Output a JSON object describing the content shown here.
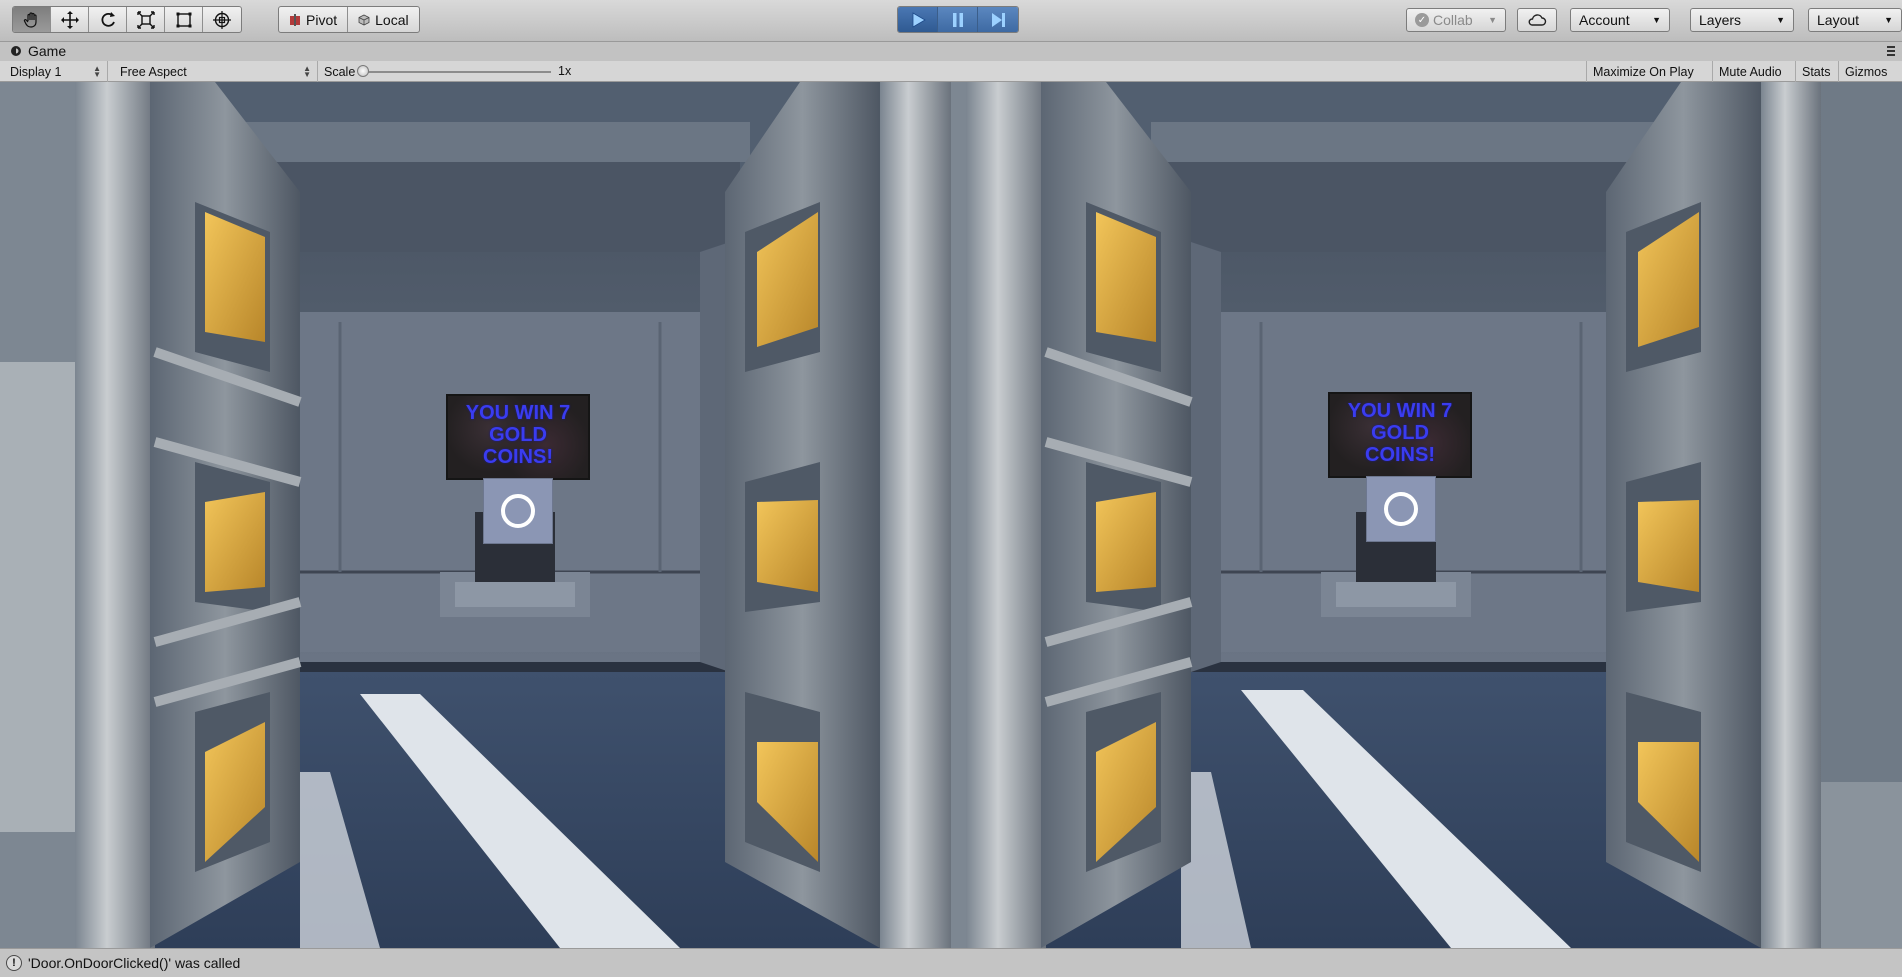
{
  "toolbar": {
    "transform_tools": [
      {
        "name": "hand-tool",
        "icon": "hand-icon",
        "active": true
      },
      {
        "name": "move-tool",
        "icon": "move-icon",
        "active": false
      },
      {
        "name": "rotate-tool",
        "icon": "rotate-icon",
        "active": false
      },
      {
        "name": "scale-tool",
        "icon": "scale-icon",
        "active": false
      },
      {
        "name": "rect-tool",
        "icon": "rect-icon",
        "active": false
      },
      {
        "name": "transform-tool",
        "icon": "transform-icon",
        "active": false
      }
    ],
    "pivot_label": "Pivot",
    "local_label": "Local",
    "play": {
      "playing": true
    },
    "collab_label": "Collab",
    "account_label": "Account",
    "layers_label": "Layers",
    "layout_label": "Layout"
  },
  "game_tab": {
    "title": "Game",
    "display": "Display 1",
    "aspect": "Free Aspect",
    "scale_label": "Scale",
    "scale_value": "1x",
    "scale_level": 0.0,
    "maximize_label": "Maximize On Play",
    "mute_label": "Mute Audio",
    "stats_label": "Stats",
    "gizmos_label": "Gizmos"
  },
  "scene": {
    "sign_text_lines": [
      "YOU WIN 7",
      "GOLD",
      "COINS!"
    ],
    "sign_color": "#3a3cf0"
  },
  "status": {
    "message": "'Door.OnDoorClicked()' was called"
  },
  "colors": {
    "accent_play": "#3e6aa3",
    "toolbar_bg": "#c8c8c8",
    "gold_panel": "#d7a63a"
  }
}
